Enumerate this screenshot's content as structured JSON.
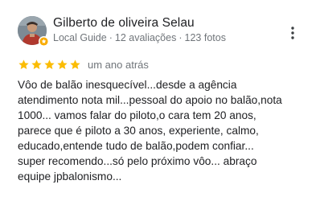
{
  "reviewer": {
    "name": "Gilberto de oliveira Selau",
    "guide_label": "Local Guide",
    "separator": "·",
    "reviews_count": "12 avaliações",
    "photos_count": "123 fotos",
    "avatar_icon": "user-avatar",
    "badge_icon": "local-guide-star-icon",
    "badge_color": "#f9ab00"
  },
  "menu": {
    "icon": "more-vert-icon"
  },
  "review": {
    "rating": 5,
    "max_rating": 5,
    "star_color": "#fbbc04",
    "date": "um ano atrás",
    "lines": [
      "Vôo de balão inesquecível...desde a agência",
      "atendimento nota mil...pessoal do apoio no balão,nota",
      "1000... vamos falar do piloto,o cara tem 20 anos,",
      "parece que é piloto a 30 anos, experiente, calmo,",
      "educado,entende tudo de balão,podem confiar...",
      "super recomendo...só pelo próximo vôo... abraço",
      "equipe jpbalonismo..."
    ]
  }
}
